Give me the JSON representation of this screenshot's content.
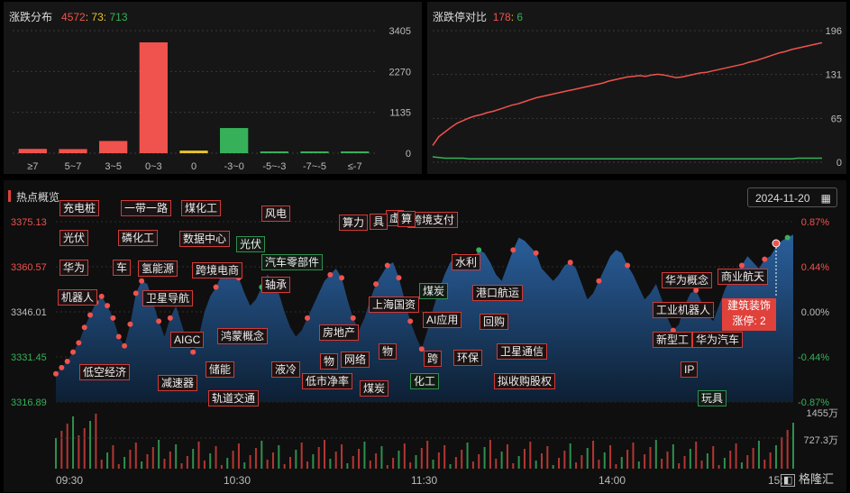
{
  "distribution": {
    "title": "涨跌分布",
    "up": "4572",
    "flat": "73",
    "down": "713",
    "sep": ":",
    "chart_data": {
      "type": "bar",
      "categories": [
        "≥7",
        "5~7",
        "3~5",
        "0~3",
        "0",
        "-3~0",
        "-5~-3",
        "-7~-5",
        "≤-7"
      ],
      "values": [
        120,
        115,
        340,
        3080,
        73,
        700,
        6,
        4,
        3
      ],
      "colors": [
        "#f0524d",
        "#f0524d",
        "#f0524d",
        "#f0524d",
        "#e6c229",
        "#36b15a",
        "#36b15a",
        "#36b15a",
        "#36b15a"
      ],
      "ylim": [
        0,
        3405
      ],
      "yticks": [
        "3405",
        "2270",
        "1135",
        "0"
      ]
    }
  },
  "limit": {
    "title": "涨跌停对比",
    "up": "178",
    "sep": ":",
    "down": "6",
    "chart_data": {
      "type": "line",
      "ylim": [
        0,
        196
      ],
      "yticks": [
        "196",
        "131",
        "65",
        "0"
      ],
      "series": [
        {
          "color": "#f0524d",
          "values": [
            25,
            38,
            45,
            52,
            58,
            62,
            66,
            69,
            71,
            74,
            76,
            79,
            82,
            85,
            87,
            90,
            93,
            96,
            98,
            100,
            102,
            104,
            106,
            108,
            110,
            112,
            114,
            116,
            118,
            121,
            123,
            125,
            127,
            128,
            129,
            128,
            130,
            131,
            130,
            128,
            126,
            127,
            129,
            131,
            133,
            134,
            136,
            138,
            140,
            142,
            144,
            146,
            149,
            151,
            154,
            157,
            160,
            163,
            165,
            168,
            170,
            172,
            174,
            176,
            178
          ]
        },
        {
          "color": "#36b15a",
          "values": [
            8,
            7,
            6,
            6,
            6,
            6,
            5,
            5,
            5,
            5,
            5,
            5,
            5,
            5,
            5,
            5,
            5,
            5,
            5,
            5,
            5,
            5,
            5,
            5,
            5,
            5,
            5,
            5,
            5,
            5,
            5,
            5,
            5,
            5,
            5,
            5,
            5,
            5,
            5,
            5,
            5,
            5,
            5,
            5,
            5,
            5,
            5,
            5,
            5,
            5,
            5,
            5,
            5,
            5,
            5,
            5,
            5,
            5,
            5,
            5,
            6,
            6,
            6,
            6,
            6
          ]
        }
      ]
    }
  },
  "hot": {
    "title": "热点概览",
    "date": "2024-11-20",
    "calendar_icon": "calendar-icon",
    "chart_data": {
      "type": "area",
      "ylim": [
        3316.89,
        3375.13
      ],
      "yticks_left": [
        "3375.13",
        "3360.57",
        "3346.01",
        "3331.45",
        "3316.89"
      ],
      "yticks_right": [
        "0.87%",
        "0.44%",
        "0.00%",
        "-0.44%",
        "-0.87%"
      ],
      "xticks": [
        "09:30",
        "10:30",
        "11:30",
        "14:00",
        "15:"
      ],
      "vol_ticks": [
        "1455万",
        "727.3万"
      ],
      "price": [
        3326,
        3328,
        3330,
        3333,
        3336,
        3341,
        3345,
        3349,
        3351,
        3348,
        3344,
        3338,
        3335,
        3342,
        3352,
        3356,
        3355,
        3349,
        3343,
        3338,
        3344,
        3348,
        3342,
        3336,
        3333,
        3338,
        3346,
        3351,
        3354,
        3358,
        3361,
        3360,
        3357,
        3352,
        3348,
        3350,
        3354,
        3358,
        3356,
        3352,
        3346,
        3341,
        3338,
        3340,
        3344,
        3348,
        3352,
        3356,
        3358,
        3360,
        3357,
        3350,
        3344,
        3340,
        3344,
        3350,
        3355,
        3358,
        3361,
        3362,
        3357,
        3350,
        3343,
        3338,
        3334,
        3340,
        3347,
        3353,
        3358,
        3362,
        3364,
        3362,
        3361,
        3363,
        3366,
        3365,
        3362,
        3358,
        3356,
        3361,
        3366,
        3370,
        3369,
        3367,
        3365,
        3360,
        3358,
        3356,
        3358,
        3361,
        3362,
        3360,
        3355,
        3350,
        3352,
        3356,
        3360,
        3364,
        3366,
        3365,
        3361,
        3358,
        3354,
        3350,
        3352,
        3355,
        3350,
        3344,
        3340,
        3342,
        3348,
        3352,
        3353,
        3349,
        3345,
        3343,
        3348,
        3353,
        3357,
        3359,
        3361,
        3364,
        3362,
        3360,
        3363,
        3364,
        3367,
        3369,
        3370,
        3371
      ]
    }
  },
  "tags": [
    {
      "t": "充电桩",
      "g": false
    },
    {
      "t": "一带一路",
      "g": false
    },
    {
      "t": "煤化工",
      "g": false
    },
    {
      "t": "风电",
      "g": false
    },
    {
      "t": "光伏",
      "g": false
    },
    {
      "t": "磷化工",
      "g": false
    },
    {
      "t": "数据中心",
      "g": false
    },
    {
      "t": "光伏",
      "g": true
    },
    {
      "t": "华为",
      "g": false
    },
    {
      "t": "车",
      "g": false
    },
    {
      "t": "氢能源",
      "g": false
    },
    {
      "t": "跨境电商",
      "g": false
    },
    {
      "t": "汽车零部件",
      "g": true
    },
    {
      "t": "机器人",
      "g": false
    },
    {
      "t": "卫星导航",
      "g": false
    },
    {
      "t": "轴承",
      "g": false
    },
    {
      "t": "AIGC",
      "g": false
    },
    {
      "t": "鸿蒙概念",
      "g": false
    },
    {
      "t": "储能",
      "g": false
    },
    {
      "t": "减速器",
      "g": false
    },
    {
      "t": "低空经济",
      "g": false
    },
    {
      "t": "轨道交通",
      "g": false
    },
    {
      "t": "算力",
      "g": false
    },
    {
      "t": "跨境支付",
      "g": false
    },
    {
      "t": "水利",
      "g": false
    },
    {
      "t": "煤炭",
      "g": true
    },
    {
      "t": "港口航运",
      "g": false
    },
    {
      "t": "上海国资",
      "g": false
    },
    {
      "t": "AI应用",
      "g": false
    },
    {
      "t": "回购",
      "g": false
    },
    {
      "t": "房地产",
      "g": false
    },
    {
      "t": "物",
      "g": false
    },
    {
      "t": "网络",
      "g": false
    },
    {
      "t": "跨",
      "g": false
    },
    {
      "t": "环保",
      "g": false
    },
    {
      "t": "卫星通信",
      "g": false
    },
    {
      "t": "液冷",
      "g": false
    },
    {
      "t": "低市净率",
      "g": false
    },
    {
      "t": "煤炭",
      "g": false
    },
    {
      "t": "化工",
      "g": true
    },
    {
      "t": "拟收购股权",
      "g": false
    },
    {
      "t": "华为概念",
      "g": false
    },
    {
      "t": "商业航天",
      "g": false
    },
    {
      "t": "工业机器人",
      "g": false
    },
    {
      "t": "新型工",
      "g": false
    },
    {
      "t": "华为汽车",
      "g": false
    },
    {
      "t": "IP",
      "g": false
    },
    {
      "t": "玩具",
      "g": true
    },
    {
      "t": "虚",
      "g": false
    },
    {
      "t": "具",
      "g": false
    },
    {
      "t": "算",
      "g": false
    },
    {
      "t": "物",
      "g": false
    }
  ],
  "tooltip": {
    "name": "建筑装饰",
    "label": "涨停:",
    "value": "2"
  },
  "brand": "格隆汇"
}
